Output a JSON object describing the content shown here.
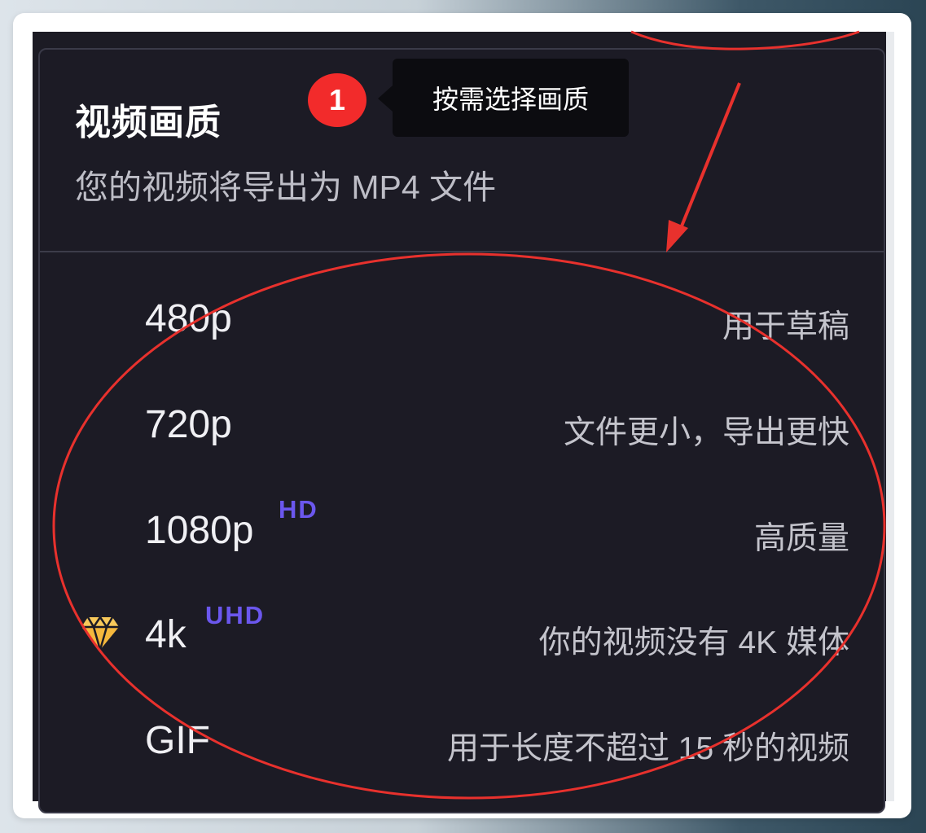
{
  "panel": {
    "title": "视频画质",
    "subtitle": "您的视频将导出为 MP4 文件"
  },
  "annotation": {
    "step_number": "1",
    "tooltip_text": "按需选择画质"
  },
  "options": [
    {
      "label": "480p",
      "tag": "",
      "description": "用于草稿",
      "premium": false
    },
    {
      "label": "720p",
      "tag": "",
      "description": "文件更小，导出更快",
      "premium": false
    },
    {
      "label": "1080p",
      "tag": "HD",
      "description": "高质量",
      "premium": false
    },
    {
      "label": "4k",
      "tag": "UHD",
      "description": "你的视频没有 4K 媒体",
      "premium": true
    },
    {
      "label": "GIF",
      "tag": "",
      "description": "用于长度不超过 15 秒的视频",
      "premium": false
    }
  ],
  "colors": {
    "panel_bg": "#1c1b25",
    "tag_accent": "#6b57ee",
    "annotation_red": "#f22b2b",
    "premium_gold": "#f5b83d"
  }
}
